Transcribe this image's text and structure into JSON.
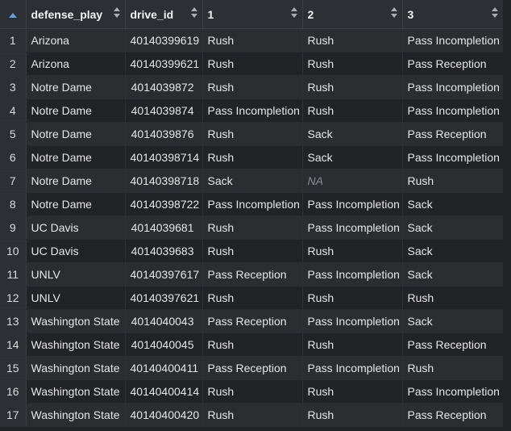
{
  "columns": [
    {
      "label": "defense_play"
    },
    {
      "label": "drive_id"
    },
    {
      "label": "1"
    },
    {
      "label": "2"
    },
    {
      "label": "3"
    }
  ],
  "rows": [
    {
      "idx": "1",
      "defense_play": "Arizona",
      "drive_id": "40140399619",
      "p1": "Rush",
      "p2": "Rush",
      "p3": "Pass Incompletion"
    },
    {
      "idx": "2",
      "defense_play": "Arizona",
      "drive_id": "40140399621",
      "p1": "Rush",
      "p2": "Rush",
      "p3": "Pass Reception"
    },
    {
      "idx": "3",
      "defense_play": "Notre Dame",
      "drive_id": "4014039872",
      "p1": "Rush",
      "p2": "Rush",
      "p3": "Pass Incompletion"
    },
    {
      "idx": "4",
      "defense_play": "Notre Dame",
      "drive_id": "4014039874",
      "p1": "Pass Incompletion",
      "p2": "Rush",
      "p3": "Pass Incompletion"
    },
    {
      "idx": "5",
      "defense_play": "Notre Dame",
      "drive_id": "4014039876",
      "p1": "Rush",
      "p2": "Sack",
      "p3": "Pass Reception"
    },
    {
      "idx": "6",
      "defense_play": "Notre Dame",
      "drive_id": "40140398714",
      "p1": "Rush",
      "p2": "Sack",
      "p3": "Pass Incompletion"
    },
    {
      "idx": "7",
      "defense_play": "Notre Dame",
      "drive_id": "40140398718",
      "p1": "Sack",
      "p2": "NA",
      "p3": "Rush"
    },
    {
      "idx": "8",
      "defense_play": "Notre Dame",
      "drive_id": "40140398722",
      "p1": "Pass Incompletion",
      "p2": "Pass Incompletion",
      "p3": "Sack"
    },
    {
      "idx": "9",
      "defense_play": "UC Davis",
      "drive_id": "4014039681",
      "p1": "Rush",
      "p2": "Pass Incompletion",
      "p3": "Sack"
    },
    {
      "idx": "10",
      "defense_play": "UC Davis",
      "drive_id": "4014039683",
      "p1": "Rush",
      "p2": "Rush",
      "p3": "Sack"
    },
    {
      "idx": "11",
      "defense_play": "UNLV",
      "drive_id": "40140397617",
      "p1": "Pass Reception",
      "p2": "Pass Incompletion",
      "p3": "Sack"
    },
    {
      "idx": "12",
      "defense_play": "UNLV",
      "drive_id": "40140397621",
      "p1": "Rush",
      "p2": "Rush",
      "p3": "Rush"
    },
    {
      "idx": "13",
      "defense_play": "Washington State",
      "drive_id": "4014040043",
      "p1": "Pass Reception",
      "p2": "Pass Incompletion",
      "p3": "Sack"
    },
    {
      "idx": "14",
      "defense_play": "Washington State",
      "drive_id": "4014040045",
      "p1": "Rush",
      "p2": "Rush",
      "p3": "Pass Reception"
    },
    {
      "idx": "15",
      "defense_play": "Washington State",
      "drive_id": "40140400411",
      "p1": "Pass Reception",
      "p2": "Pass Incompletion",
      "p3": "Rush"
    },
    {
      "idx": "16",
      "defense_play": "Washington State",
      "drive_id": "40140400414",
      "p1": "Rush",
      "p2": "Rush",
      "p3": "Pass Incompletion"
    },
    {
      "idx": "17",
      "defense_play": "Washington State",
      "drive_id": "40140400420",
      "p1": "Rush",
      "p2": "Rush",
      "p3": "Pass Reception"
    }
  ],
  "colors": {
    "background": "#222326",
    "header": "#2c2f33",
    "row_odd": "#2b2d30",
    "row_even": "#222326",
    "sort_active": "#5aa0e6",
    "na_text": "#8a8f96"
  }
}
